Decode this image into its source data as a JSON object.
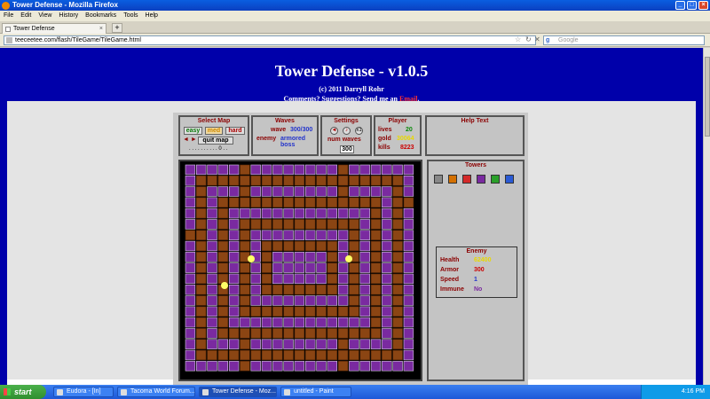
{
  "window": {
    "title": "Tower Defense - Mozilla Firefox"
  },
  "menu": [
    "File",
    "Edit",
    "View",
    "History",
    "Bookmarks",
    "Tools",
    "Help"
  ],
  "tab": {
    "label": "Tower Defense",
    "new_tab": "+"
  },
  "nav": {
    "url": "teeceetee.com/flash/TileGame/TileGame.html",
    "search_placeholder": "Google"
  },
  "page": {
    "title": "Tower Defense - v1.0.5",
    "copyright": "(c) 2011 Darryll Rohr",
    "suggestions_prefix": "Comments? Suggestions? Send me an ",
    "email_link": "Email",
    "suggestions_suffix": "."
  },
  "game": {
    "select_map": {
      "title": "Select Map",
      "easy": "easy",
      "med": "med",
      "hard": "hard",
      "quit": "quit map",
      "arrows": "◄ ►",
      "dots": ". . . . . . . . . . 0 . ."
    },
    "waves": {
      "title": "Waves",
      "wave_label": "wave",
      "wave_value": "300/300",
      "enemy_label": "enemy",
      "enemy_value": "armored boss"
    },
    "settings": {
      "title": "Settings",
      "num_waves_label": "num waves",
      "num_waves_value": "300",
      "speed_label": "x1"
    },
    "player": {
      "title": "Player",
      "lives_label": "lives",
      "lives_value": "20",
      "gold_label": "gold",
      "gold_value": "30064",
      "kills_label": "kills",
      "kills_value": "8223"
    },
    "help": {
      "title": "Help Text"
    },
    "towers": {
      "title": "Towers"
    },
    "enemy": {
      "title": "Enemy",
      "health_label": "Health",
      "health_value": "62400",
      "armor_label": "Armor",
      "armor_value": "300",
      "speed_label": "Speed",
      "speed_value": "1",
      "immune_label": "Immune",
      "immune_value": "No"
    }
  },
  "taskbar": {
    "start": "start",
    "tasks": [
      "Eudora - [In]",
      "Tacoma World Forum...",
      "Tower Defense - Moz...",
      "untitled - Paint"
    ],
    "time": "4:16 PM"
  },
  "colors": {
    "accent_blue": "#0000aa",
    "path_brown": "#8b4513",
    "tower_purple": "#7a2aa0"
  }
}
